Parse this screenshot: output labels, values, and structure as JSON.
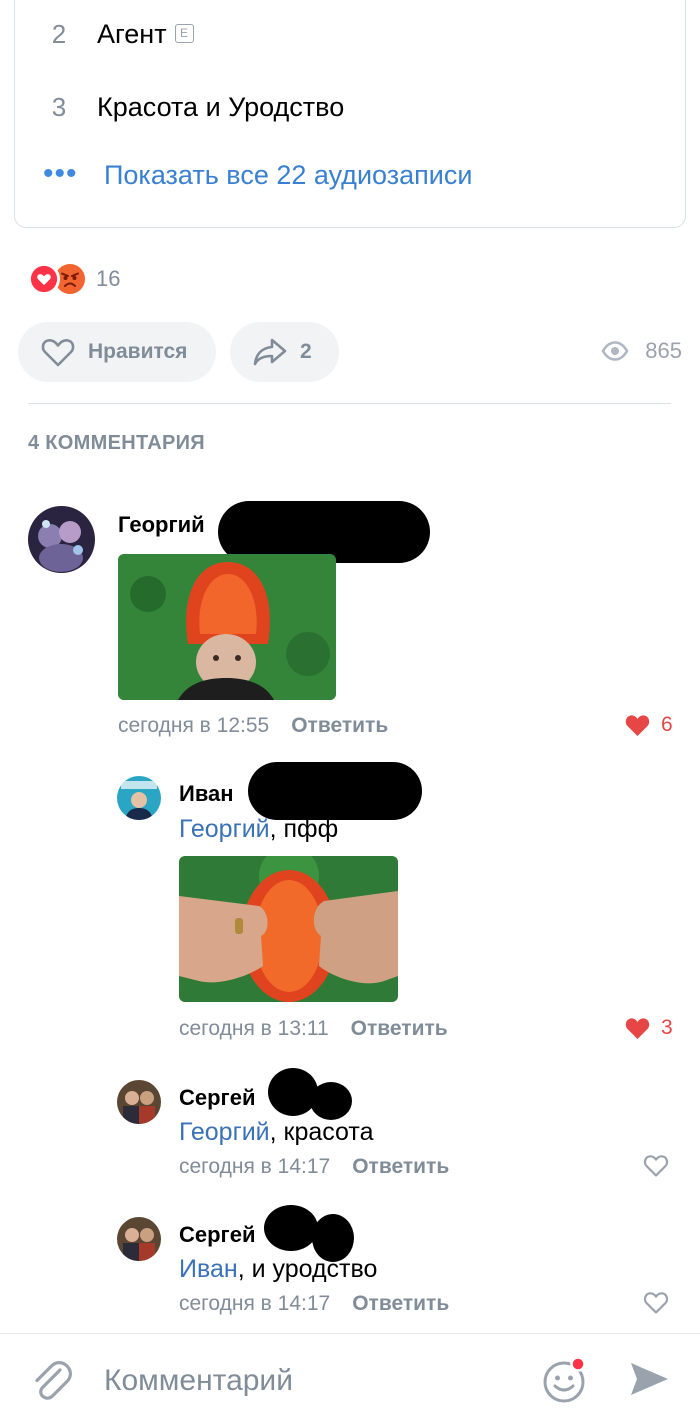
{
  "audio": {
    "tracks": [
      {
        "num": "2",
        "title": "Агент",
        "explicit": "E"
      },
      {
        "num": "3",
        "title": "Красота и Уродство"
      }
    ],
    "show_all": "Показать все 22 аудиозаписи"
  },
  "post": {
    "reactions_count": "16",
    "like_label": "Нравится",
    "share_count": "2",
    "views": "865"
  },
  "comments_header": "4 КОММЕНТАРИЯ",
  "comments": [
    {
      "author": "Георгий",
      "time": "сегодня в 12:55",
      "reply": "Ответить",
      "likes": "6"
    },
    {
      "author": "Иван",
      "mention": "Георгий",
      "text": ", пфф",
      "time": "сегодня в 13:11",
      "reply": "Ответить",
      "likes": "3"
    },
    {
      "author": "Сергей",
      "mention": "Георгий",
      "text": ", красота",
      "time": "сегодня в 14:17",
      "reply": "Ответить"
    },
    {
      "author": "Сергей",
      "mention": "Иван",
      "text": ", и уродство",
      "time": "сегодня в 14:17",
      "reply": "Ответить"
    }
  ],
  "composer": {
    "placeholder": "Комментарий"
  },
  "colors": {
    "accent": "#3a80d0",
    "like": "#e64646",
    "muted": "#818c99"
  }
}
